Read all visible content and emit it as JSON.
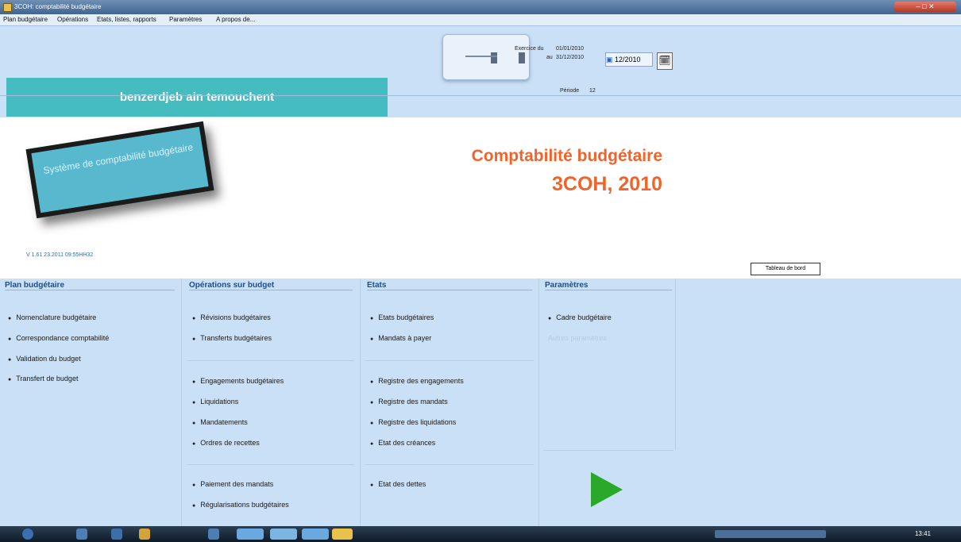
{
  "window": {
    "title": "3COH: comptabilité budgétaire"
  },
  "menu": [
    "Plan budgétaire",
    "Opérations",
    "Etats, listes, rapports",
    "Paramètres",
    "A propos de..."
  ],
  "period": {
    "from_label": "Exercice du",
    "from_value": "01/01/2010",
    "to_label": "au",
    "to_value": "31/12/2010",
    "month_label": "Période",
    "month_value": "12",
    "current_value": "12/2010"
  },
  "organization": "benzerdjeb ain temouchent",
  "logo_text": "Système de comptabilité budgétaire",
  "brand": {
    "title": "Comptabilité budgétaire",
    "subtitle": "3COH, 2010"
  },
  "version": "V 1.61 23.2011 09:55HH32",
  "dashboard_button": "Tableau de bord",
  "columns": [
    {
      "title": "Plan budgétaire",
      "groups": [
        [
          "Nomenclature budgétaire",
          "Correspondance comptabilité",
          "Validation du budget",
          "Transfert de budget"
        ]
      ]
    },
    {
      "title": "Opérations sur budget",
      "groups": [
        [
          "Révisions budgétaires",
          "Transferts budgétaires"
        ],
        [
          "Engagements budgétaires",
          "Liquidations",
          "Mandatements",
          "Ordres de recettes"
        ],
        [
          "Paiement des mandats",
          "Régularisations budgétaires"
        ]
      ]
    },
    {
      "title": "Etats",
      "groups": [
        [
          "Etats budgétaires",
          "Mandats à payer"
        ],
        [
          "Registre des engagements",
          "Registre des mandats",
          "Registre des liquidations",
          "Etat des créances"
        ],
        [
          "Etat des dettes"
        ]
      ]
    },
    {
      "title": "Paramètres",
      "groups": [
        [
          "Cadre budgétaire"
        ]
      ],
      "disabled_item": "Autres paramètres"
    }
  ],
  "taskbar": {
    "clock": "13:41"
  },
  "colors": {
    "accent": "#44bcc0",
    "brand": "#f0642c",
    "panel": "#c9e0f6",
    "play": "#2aa82a"
  }
}
